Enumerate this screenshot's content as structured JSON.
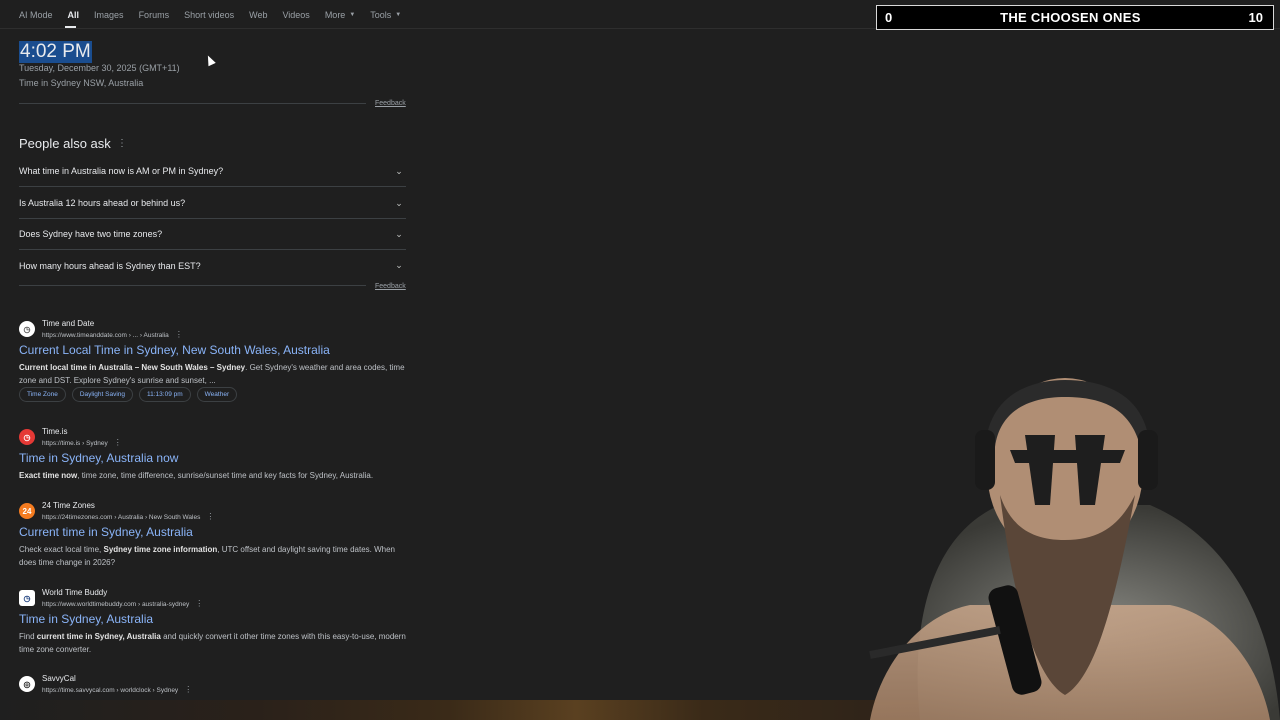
{
  "tabs": [
    {
      "label": "AI Mode"
    },
    {
      "label": "All",
      "active": true
    },
    {
      "label": "Images"
    },
    {
      "label": "Forums"
    },
    {
      "label": "Short videos"
    },
    {
      "label": "Web"
    },
    {
      "label": "Videos"
    },
    {
      "label": "More",
      "dropdown": true
    },
    {
      "label": "Tools",
      "dropdown": true
    }
  ],
  "scoreboard": {
    "left_score": "0",
    "title": "THE CHOOSEN ONES",
    "right_score": "10"
  },
  "time_panel": {
    "time": "4:02 PM",
    "date": "Tuesday, December 30, 2025 (GMT+11)",
    "location": "Time in Sydney NSW, Australia",
    "feedback": "Feedback"
  },
  "people_also_ask": {
    "title": "People also ask",
    "questions": [
      "What time in Australia now is AM or PM in Sydney?",
      "Is Australia 12 hours ahead or behind us?",
      "Does Sydney have two time zones?",
      "How many hours ahead is Sydney than EST?"
    ],
    "feedback": "Feedback"
  },
  "results": [
    {
      "site": "Time and Date",
      "url": "https://www.timeanddate.com › ... › Australia",
      "title": "Current Local Time in Sydney, New South Wales, Australia",
      "snippet_bold": "Current local time in Australia – New South Wales – Sydney",
      "snippet": ". Get Sydney's weather and area codes, time zone and DST. Explore Sydney's sunrise and sunset, ...",
      "chips": [
        "Time Zone",
        "Daylight Saving",
        "11:13:09 pm",
        "Weather"
      ],
      "icon": "timeanddate-icon",
      "icon_color": "#ffffff"
    },
    {
      "site": "Time.is",
      "url": "https://time.is › Sydney",
      "title": "Time in Sydney, Australia now",
      "snippet_bold": "Exact time now",
      "snippet": ", time zone, time difference, sunrise/sunset time and key facts for Sydney, Australia.",
      "icon": "timeis-icon",
      "icon_color": "#e53935"
    },
    {
      "site": "24 Time Zones",
      "url": "https://24timezones.com › Australia › New South Wales",
      "title": "Current time in Sydney, Australia",
      "snippet_pre": "Check exact local time, ",
      "snippet_bold": "Sydney time zone information",
      "snippet": ", UTC offset and daylight saving time dates. When does time change in 2026?",
      "icon_text": "24",
      "icon": "24timezones-icon",
      "icon_color": "#f57c20"
    },
    {
      "site": "World Time Buddy",
      "url": "https://www.worldtimebuddy.com › australia-sydney",
      "title": "Time in Sydney, Australia",
      "snippet_pre": "Find ",
      "snippet_bold": "current time in Sydney, Australia",
      "snippet": " and quickly convert it other time zones with this easy-to-use, modern time zone converter.",
      "icon": "worldtimebuddy-icon",
      "icon_color": "#ffffff"
    },
    {
      "site": "SavvyCal",
      "url": "https://time.savvycal.com › worldclock › Sydney",
      "icon": "savvycal-icon",
      "icon_color": "#ffffff"
    }
  ],
  "colors": {
    "background": "#1f1f1f",
    "link": "#8ab4f8",
    "selection": "#1a4d8f"
  }
}
